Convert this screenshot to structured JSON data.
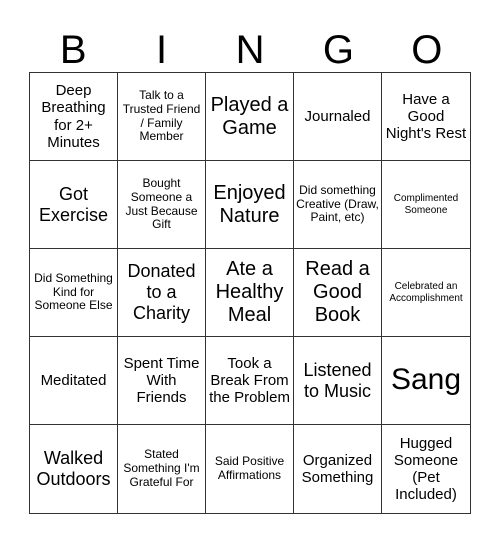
{
  "header": [
    "B",
    "I",
    "N",
    "G",
    "O"
  ],
  "cells": [
    {
      "text": "Deep Breathing for 2+ Minutes",
      "size": "m"
    },
    {
      "text": "Talk to a Trusted Friend / Family Member",
      "size": "s"
    },
    {
      "text": "Played a Game",
      "size": "xl"
    },
    {
      "text": "Journaled",
      "size": "m"
    },
    {
      "text": "Have a Good Night's Rest",
      "size": "m"
    },
    {
      "text": "Got Exercise",
      "size": "l"
    },
    {
      "text": "Bought Someone a Just Because Gift",
      "size": "s"
    },
    {
      "text": "Enjoyed Nature",
      "size": "xl"
    },
    {
      "text": "Did something Creative (Draw, Paint, etc)",
      "size": "s"
    },
    {
      "text": "Complimented Someone",
      "size": "xs"
    },
    {
      "text": "Did Something Kind for Someone Else",
      "size": "s"
    },
    {
      "text": "Donated to a Charity",
      "size": "l"
    },
    {
      "text": "Ate a Healthy Meal",
      "size": "xl"
    },
    {
      "text": "Read a Good Book",
      "size": "xl"
    },
    {
      "text": "Celebrated an Accomplishment",
      "size": "xs"
    },
    {
      "text": "Meditated",
      "size": "m"
    },
    {
      "text": "Spent Time With Friends",
      "size": "m"
    },
    {
      "text": "Took a Break From the Problem",
      "size": "m"
    },
    {
      "text": "Listened to Music",
      "size": "l"
    },
    {
      "text": "Sang",
      "size": "xxl"
    },
    {
      "text": "Walked Outdoors",
      "size": "l"
    },
    {
      "text": "Stated Something I'm Grateful For",
      "size": "s"
    },
    {
      "text": "Said Positive Affirmations",
      "size": "s"
    },
    {
      "text": "Organized Something",
      "size": "m"
    },
    {
      "text": "Hugged Someone (Pet Included)",
      "size": "m"
    }
  ]
}
